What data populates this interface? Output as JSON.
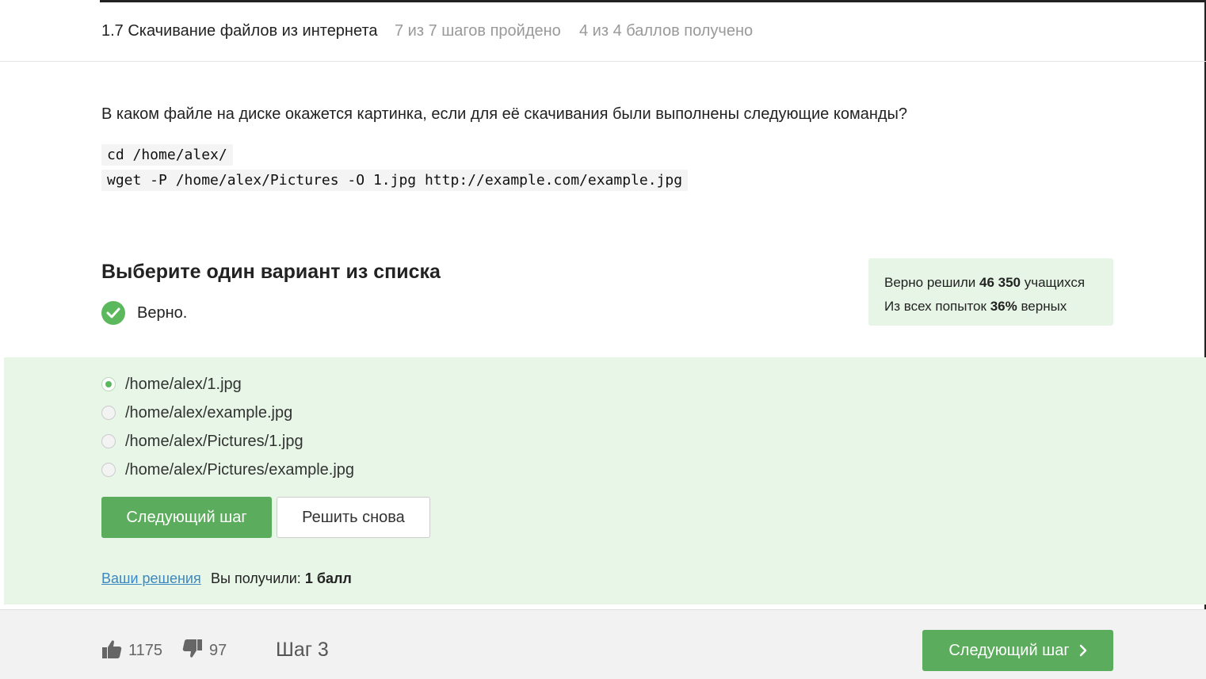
{
  "header": {
    "lesson_title": "1.7 Скачивание файлов из интернета",
    "steps_progress": "7 из 7 шагов пройдено",
    "points_progress": "4 из 4 баллов  получено"
  },
  "question": {
    "text": "В каком файле на диске окажется картинка, если для её скачивания были выполнены следующие команды?",
    "code_lines": [
      "cd /home/alex/",
      "wget -P /home/alex/Pictures -O 1.jpg http://example.com/example.jpg"
    ]
  },
  "quiz": {
    "title": "Выберите один вариант из списка",
    "result_text": "Верно.",
    "options": [
      {
        "label": "/home/alex/1.jpg",
        "selected": true
      },
      {
        "label": "/home/alex/example.jpg",
        "selected": false
      },
      {
        "label": "/home/alex/Pictures/1.jpg",
        "selected": false
      },
      {
        "label": "/home/alex/Pictures/example.jpg",
        "selected": false
      }
    ],
    "next_button": "Следующий шаг",
    "retry_button": "Решить снова",
    "solutions_link": "Ваши решения",
    "received_label": "Вы получили:",
    "received_value": "1 балл"
  },
  "stats": {
    "solved_prefix": "Верно решили",
    "solved_count": "46 350",
    "solved_suffix": "учащихся",
    "attempts_prefix": "Из всех попыток",
    "attempts_percent": "36%",
    "attempts_suffix": "верных"
  },
  "footer": {
    "likes": "1175",
    "dislikes": "97",
    "step_label": "Шаг 3",
    "next_button": "Следующий шаг"
  },
  "colors": {
    "accent_green": "#5bac5c",
    "panel_green": "#e7f6e7",
    "link_blue": "#3b88c3"
  },
  "icons": {
    "check": "check-circle-icon",
    "like": "thumbs-up-icon",
    "dislike": "thumbs-down-icon",
    "chevron": "chevron-right-icon"
  }
}
